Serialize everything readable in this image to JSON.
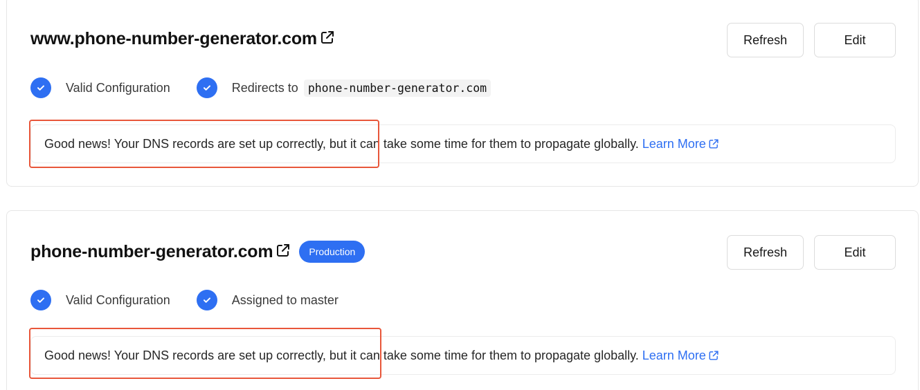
{
  "cards": [
    {
      "domain": "www.phone-number-generator.com",
      "badge": "",
      "buttons": {
        "refresh": "Refresh",
        "edit": "Edit"
      },
      "statuses": [
        {
          "label": "Valid Configuration",
          "code": ""
        },
        {
          "label": "Redirects to",
          "code": "phone-number-generator.com"
        }
      ],
      "notice": {
        "text": "Good news! Your DNS records are set up correctly, but it can take some time for them to propagate globally.",
        "link": "Learn More"
      }
    },
    {
      "domain": "phone-number-generator.com",
      "badge": "Production",
      "buttons": {
        "refresh": "Refresh",
        "edit": "Edit"
      },
      "statuses": [
        {
          "label": "Valid Configuration",
          "code": ""
        },
        {
          "label": "Assigned to master",
          "code": ""
        }
      ],
      "notice": {
        "text": "Good news! Your DNS records are set up correctly, but it can take some time for them to propagate globally.",
        "link": "Learn More"
      }
    }
  ],
  "colors": {
    "accent": "#2e6ff2",
    "highlight": "#e8563a",
    "border": "#e6e6e6"
  },
  "icons": [
    "external-link-icon",
    "check-circle-icon"
  ]
}
